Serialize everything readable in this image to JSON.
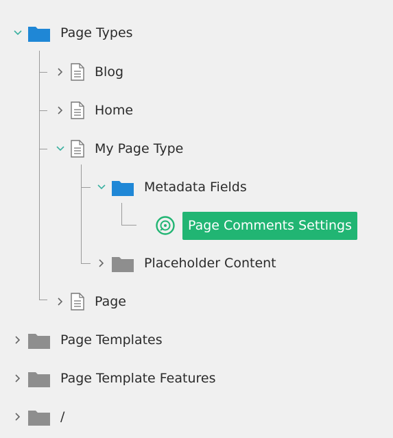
{
  "tree": {
    "page_types": {
      "label": "Page Types",
      "expanded": true
    },
    "blog": {
      "label": "Blog"
    },
    "home": {
      "label": "Home"
    },
    "my_page_type": {
      "label": "My Page Type",
      "expanded": true
    },
    "metadata_fields": {
      "label": "Metadata Fields",
      "expanded": true
    },
    "page_comments_settings": {
      "label": "Page Comments Settings",
      "selected": true
    },
    "placeholder_content": {
      "label": "Placeholder Content"
    },
    "page": {
      "label": "Page"
    },
    "page_templates": {
      "label": "Page Templates"
    },
    "page_template_features": {
      "label": "Page Template Features"
    },
    "root_slash": {
      "label": "/"
    }
  },
  "colors": {
    "background": "#f0f0f0",
    "folder_blue": "#1f87d6",
    "folder_gray": "#8e8e8e",
    "chevron_expanded": "#3ab0a0",
    "chevron_collapsed": "#666666",
    "tree_line": "#9a9a9a",
    "selected_bg": "#21b573",
    "selected_text": "#ffffff",
    "component_icon": "#21b573"
  }
}
